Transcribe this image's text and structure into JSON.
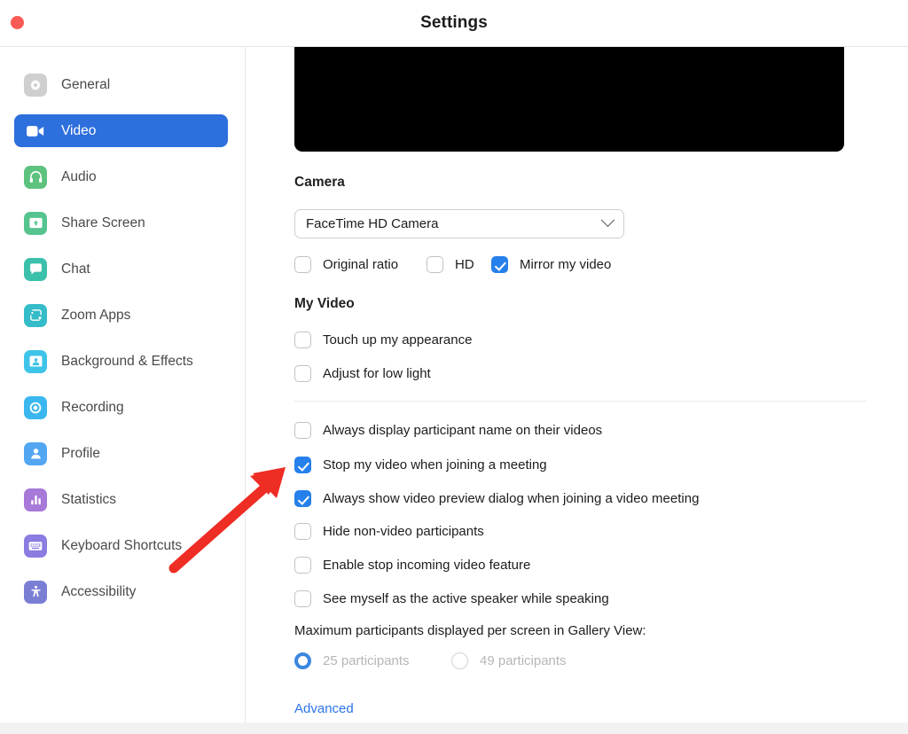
{
  "window": {
    "title": "Settings",
    "close_button": "close-button"
  },
  "sidebar": {
    "items": [
      {
        "label": "General",
        "icon": "gear-icon",
        "color": "#cfcfcf",
        "active": false
      },
      {
        "label": "Video",
        "icon": "video-camera-icon",
        "color": "#2d6fdd",
        "active": true
      },
      {
        "label": "Audio",
        "icon": "headphones-icon",
        "color": "#5ec27f",
        "active": false
      },
      {
        "label": "Share Screen",
        "icon": "share-screen-icon",
        "color": "#56c48f",
        "active": false
      },
      {
        "label": "Chat",
        "icon": "chat-bubble-icon",
        "color": "#3bc0ab",
        "active": false
      },
      {
        "label": "Zoom Apps",
        "icon": "zoom-apps-icon",
        "color": "#34bcc8",
        "active": false
      },
      {
        "label": "Background & Effects",
        "icon": "background-effects-icon",
        "color": "#3ec4e8",
        "active": false
      },
      {
        "label": "Recording",
        "icon": "recording-icon",
        "color": "#3ab7ef",
        "active": false
      },
      {
        "label": "Profile",
        "icon": "profile-icon",
        "color": "#52a6f2",
        "active": false
      },
      {
        "label": "Statistics",
        "icon": "statistics-icon",
        "color": "#a779d8",
        "active": false
      },
      {
        "label": "Keyboard Shortcuts",
        "icon": "keyboard-icon",
        "color": "#8a7ce0",
        "active": false
      },
      {
        "label": "Accessibility",
        "icon": "accessibility-icon",
        "color": "#7b7fd4",
        "active": false
      }
    ]
  },
  "main": {
    "camera_section_title": "Camera",
    "camera_select": {
      "value": "FaceTime HD Camera",
      "chevron": "chevron-down-icon"
    },
    "camera_options": [
      {
        "label": "Original ratio",
        "checked": false
      },
      {
        "label": "HD",
        "checked": false
      },
      {
        "label": "Mirror my video",
        "checked": true
      }
    ],
    "my_video_section_title": "My Video",
    "my_video_options": [
      {
        "label": "Touch up my appearance",
        "checked": false
      },
      {
        "label": "Adjust for low light",
        "checked": false
      }
    ],
    "general_options": [
      {
        "label": "Always display participant name on their videos",
        "checked": false
      },
      {
        "label": "Stop my video when joining a meeting",
        "checked": true
      },
      {
        "label": "Always show video preview dialog when joining a video meeting",
        "checked": true
      },
      {
        "label": "Hide non-video participants",
        "checked": false
      },
      {
        "label": "Enable stop incoming video feature",
        "checked": false
      },
      {
        "label": "See myself as the active speaker while speaking",
        "checked": false
      }
    ],
    "gallery_label": "Maximum participants displayed per screen in Gallery View:",
    "gallery_options": [
      {
        "label": "25 participants",
        "selected": true
      },
      {
        "label": "49 participants",
        "selected": false
      }
    ],
    "advanced_link": "Advanced"
  },
  "annotation": {
    "arrow_color": "#ee2d24",
    "points_at": "Stop my video when joining a meeting"
  },
  "colors": {
    "accent_blue": "#2680eb",
    "nav_active_blue": "#2d6fdd",
    "link_blue": "#2a74e8",
    "close_red": "#fb5b55",
    "disabled_gray": "#b6b6b6"
  }
}
